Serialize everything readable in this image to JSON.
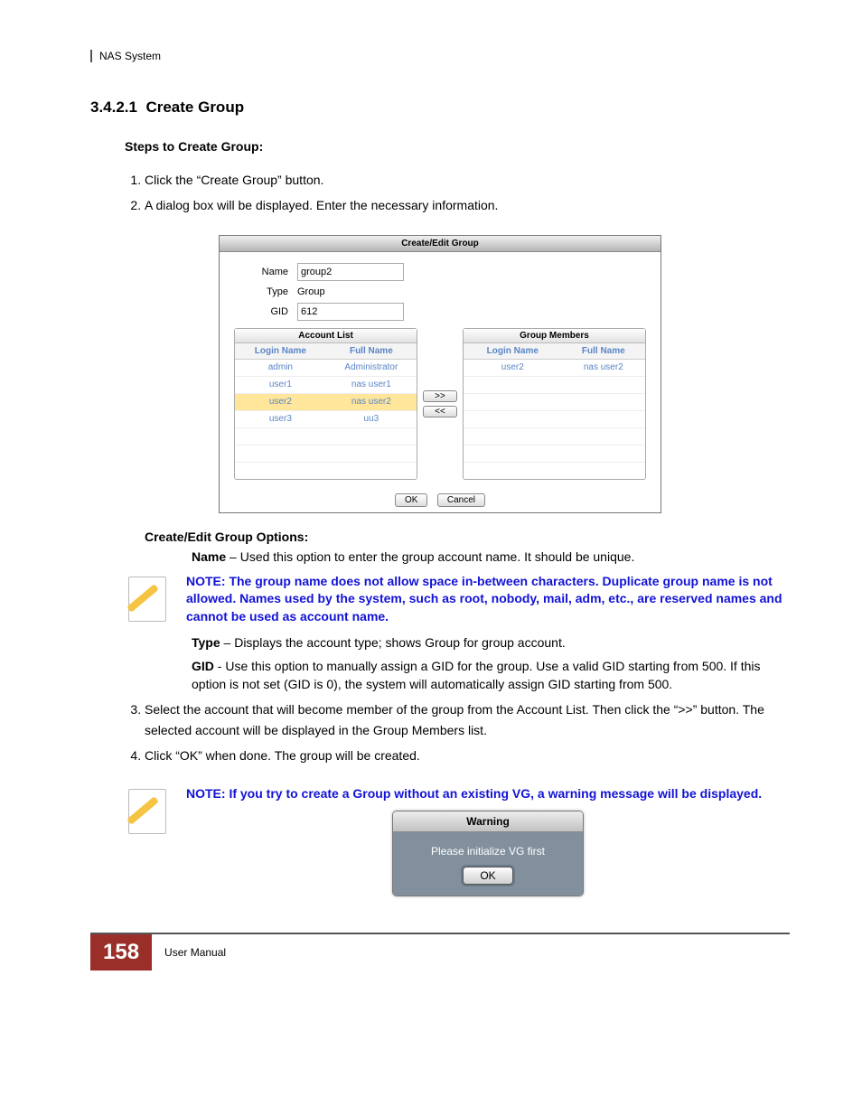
{
  "header": {
    "product": "NAS System"
  },
  "section": {
    "number": "3.4.2.1",
    "title": "Create Group",
    "steps_heading": "Steps to Create Group:",
    "steps": [
      "Click the “Create Group” button.",
      "A dialog box will be displayed. Enter the necessary information."
    ],
    "steps_after": [
      "Select the account that will become member of the group from the Account List. Then click the “>>” button. The selected account will be displayed in the Group Members list.",
      "Click “OK” when done. The group will be created."
    ]
  },
  "dialog": {
    "title": "Create/Edit Group",
    "labels": {
      "name": "Name",
      "type": "Type",
      "gid": "GID"
    },
    "values": {
      "name": "group2",
      "type": "Group",
      "gid": "612"
    },
    "account_list_title": "Account List",
    "group_members_title": "Group Members",
    "columns": {
      "login": "Login Name",
      "full": "Full Name"
    },
    "accounts": [
      {
        "login": "admin",
        "full": "Administrator"
      },
      {
        "login": "user1",
        "full": "nas user1"
      },
      {
        "login": "user2",
        "full": "nas user2",
        "selected": true
      },
      {
        "login": "user3",
        "full": "uu3"
      }
    ],
    "members": [
      {
        "login": "user2",
        "full": "nas user2"
      }
    ],
    "shuttle": {
      "add": ">>",
      "remove": "<<"
    },
    "footer": {
      "ok": "OK",
      "cancel": "Cancel"
    }
  },
  "options": {
    "heading": "Create/Edit Group Options:",
    "name_label": "Name",
    "name_text": " – Used this option to enter the group account name. It should be unique.",
    "type_label": "Type",
    "type_text": " – Displays the account type; shows Group for group account.",
    "gid_label": "GID",
    "gid_text": " - Use this option to manually assign a GID for the group. Use a valid GID starting from 500. If this option is not set (GID is 0), the system will automatically assign GID starting from 500."
  },
  "notes": {
    "first": "NOTE: The group name does not allow space in-between characters. Duplicate group name is not allowed. Names used by the system, such as root, nobody, mail, adm, etc., are reserved names and cannot be used as account name.",
    "second": "NOTE: If you try to create a Group without an existing VG, a warning message will be displayed."
  },
  "warning": {
    "title": "Warning",
    "message": "Please initialize VG first",
    "ok": "OK"
  },
  "footer": {
    "page_number": "158",
    "label": "User Manual"
  }
}
